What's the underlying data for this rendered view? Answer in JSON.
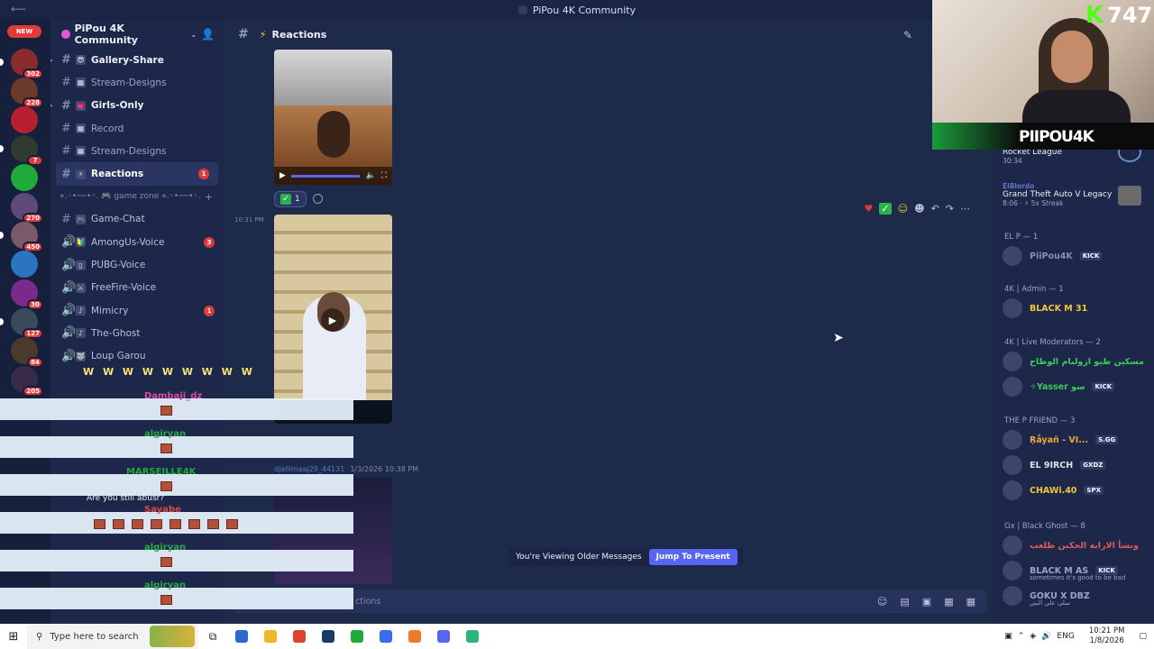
{
  "window": {
    "title": "PiPou 4K Community",
    "back_icon": "arrow-left-icon"
  },
  "server_rail": {
    "new_badge": "NEW",
    "servers": [
      {
        "badge": "302",
        "color": "#8a2c2c"
      },
      {
        "badge": "228",
        "color": "#6b3a2a"
      },
      {
        "badge": "",
        "color": "#b82030"
      },
      {
        "badge": "7",
        "color": "#2e3b2e"
      },
      {
        "badge": "",
        "color": "#1faa3a"
      },
      {
        "badge": "270",
        "color": "#5d4a7a"
      },
      {
        "badge": "450",
        "color": "#7a5a6a"
      },
      {
        "badge": "",
        "color": "#2a74c0"
      },
      {
        "badge": "30",
        "color": "#7a2a8a"
      },
      {
        "badge": "127",
        "color": "#3a4a5a"
      },
      {
        "badge": "84",
        "color": "#4a3a2a"
      },
      {
        "badge": "205",
        "color": "#3a2a4a"
      }
    ]
  },
  "sidebar": {
    "server_name": "PiPou 4K Community",
    "channels": [
      {
        "icon": "hash",
        "emoji": "😎",
        "label": "Gallery-Share",
        "bold": true,
        "badge": ""
      },
      {
        "icon": "hash",
        "emoji": "▦",
        "label": "Stream-Designs",
        "bold": false,
        "badge": ""
      },
      {
        "icon": "hash",
        "emoji": "💗",
        "label": "Girls-Only",
        "bold": true,
        "badge": ""
      },
      {
        "icon": "hash",
        "emoji": "▦",
        "label": "Record",
        "bold": false,
        "badge": ""
      },
      {
        "icon": "hash",
        "emoji": "▦",
        "label": "Stream-Designs",
        "bold": false,
        "badge": ""
      },
      {
        "icon": "hash",
        "emoji": "⚡",
        "label": "Reactions",
        "bold": true,
        "badge": "1",
        "active": true
      }
    ],
    "category_label": "⋄.◦•──•◦. 🎮 game zone ⋄.◦•──•◦.",
    "game_channels": [
      {
        "icon": "hash",
        "emoji": "🎮",
        "label": "Game-Chat",
        "badge": ""
      },
      {
        "icon": "speaker",
        "emoji": "🔰",
        "label": "AmongUs-Voice",
        "badge": "3"
      },
      {
        "icon": "speaker",
        "emoji": "▯",
        "label": "PUBG-Voice",
        "badge": ""
      },
      {
        "icon": "speaker",
        "emoji": "⚔",
        "label": "FreeFire-Voice",
        "badge": ""
      },
      {
        "icon": "speaker",
        "emoji": "♪",
        "label": "Mimicry",
        "badge": "1"
      },
      {
        "icon": "speaker",
        "emoji": "♪",
        "label": "The-Ghost",
        "badge": ""
      },
      {
        "icon": "speaker",
        "emoji": "🐺",
        "label": "Loup Garou",
        "badge": ""
      }
    ]
  },
  "main": {
    "channel_name": "Reactions",
    "timestamp_1": "10:31 PM",
    "reaction_count": "1",
    "toolbar_icons": [
      "heart-icon",
      "check-icon",
      "laugh-icon",
      "emoji-icon",
      "reply-icon",
      "forward-icon",
      "more-icon"
    ],
    "author": "djalilmaaj29_44131",
    "author_date": "1/3/2026 10:38 PM",
    "older_messages": "You're Viewing Older Messages",
    "jump_button": "Jump To Present",
    "composer_placeholder": "ctions",
    "are_you_still": "Are you still abusr?"
  },
  "members": {
    "activities": [
      {
        "title": "Rocket League",
        "sub": "30:34"
      },
      {
        "author": "ElBlordo",
        "title": "Grand Theft Auto V Legacy",
        "sub": "8:06 · ⚡ 5x Streak"
      }
    ],
    "groups": [
      {
        "label": "EL P — 1",
        "members": [
          {
            "name": "PiiPou4K",
            "color": "#8a8fb0",
            "tag": "KICK"
          }
        ]
      },
      {
        "label": "4K | Admin — 1",
        "members": [
          {
            "name": "BLACK M 31",
            "color": "#f0c63a",
            "tag": ""
          }
        ]
      },
      {
        "label": "4K | Live Moderators — 2",
        "members": [
          {
            "name": "مسكين طيو ازولبام الوطاح",
            "color": "#3fc95a",
            "tag": ""
          },
          {
            "name": "✧Yasser سو",
            "color": "#3fc95a",
            "tag": "KICK"
          }
        ]
      },
      {
        "label": "THE P FRIEND — 3",
        "members": [
          {
            "name": "Ŗåyañ - VI...",
            "color": "#f0a83a",
            "tag": "S.GG"
          },
          {
            "name": "EL 9IRCH",
            "color": "#e0e0e0",
            "tag": "GXDZ"
          },
          {
            "name": "CHAWi.40",
            "color": "#f0c63a",
            "tag": "SPX"
          }
        ]
      },
      {
        "label": "Gx | Black Ghost — 8",
        "members": [
          {
            "name": "ونشأ الارابة الحكبن طلعب",
            "color": "#e05a5a",
            "tag": ""
          },
          {
            "name": "BLACK M AS",
            "color": "#9aa5c6",
            "tag": "KICK",
            "sub": "sometimes it's good to be bad"
          },
          {
            "name": "GOKU X DBZ",
            "color": "#9aa5c6",
            "tag": "",
            "sub": "سلي علي النبي"
          }
        ]
      }
    ]
  },
  "webcam": {
    "kick_count": "747",
    "kick_letter": "K",
    "streamer_name": "PIIPOU4K"
  },
  "chat_overlay": {
    "top_ws": "W W W W W W W W W",
    "entries": [
      {
        "name": "Dambaji_dz",
        "color": "#d94aa8"
      },
      {
        "name": "algiryan",
        "color": "#2ba84a"
      },
      {
        "name": "MARSEILLE4K",
        "color": "#1faa3a"
      },
      {
        "name": "Sayabe",
        "color": "#d94a4a"
      },
      {
        "name": "algiryan",
        "color": "#2ba84a"
      },
      {
        "name": "algiryan",
        "color": "#2ba84a"
      }
    ]
  },
  "taskbar": {
    "search_placeholder": "Type here to search",
    "lang": "ENG",
    "time": "10:21 PM",
    "date": "1/8/2026",
    "apps": [
      "#2a6ad0",
      "#f0b62a",
      "#e0432a",
      "#1a3a6a",
      "#1faa3a",
      "#3a6af0",
      "#f07a2a",
      "#5865f2",
      "#2ab57a"
    ]
  }
}
